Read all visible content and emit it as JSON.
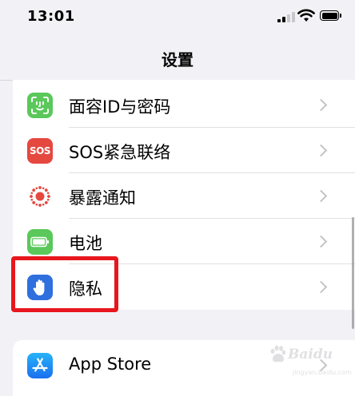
{
  "status_bar": {
    "time": "13:01"
  },
  "header": {
    "title": "设置"
  },
  "settings_group": [
    {
      "label": "面容ID与密码",
      "icon": "face-id-icon",
      "color": "#5ac85a"
    },
    {
      "label": "SOS紧急联络",
      "icon": "sos-icon",
      "color": "#e5483f",
      "icon_text": "SOS"
    },
    {
      "label": "暴露通知",
      "icon": "exposure-notification-icon",
      "color": "#ffffff"
    },
    {
      "label": "电池",
      "icon": "battery-icon",
      "color": "#5ac85a"
    },
    {
      "label": "隐私",
      "icon": "privacy-hand-icon",
      "color": "#2f6fde"
    }
  ],
  "apps_group": [
    {
      "label": "App Store",
      "icon": "app-store-icon",
      "color": "#1a8cf5"
    }
  ],
  "highlight_color": "#e8161d",
  "watermark": {
    "text": "Baidu",
    "sub": "jingyan.baidu.com"
  }
}
